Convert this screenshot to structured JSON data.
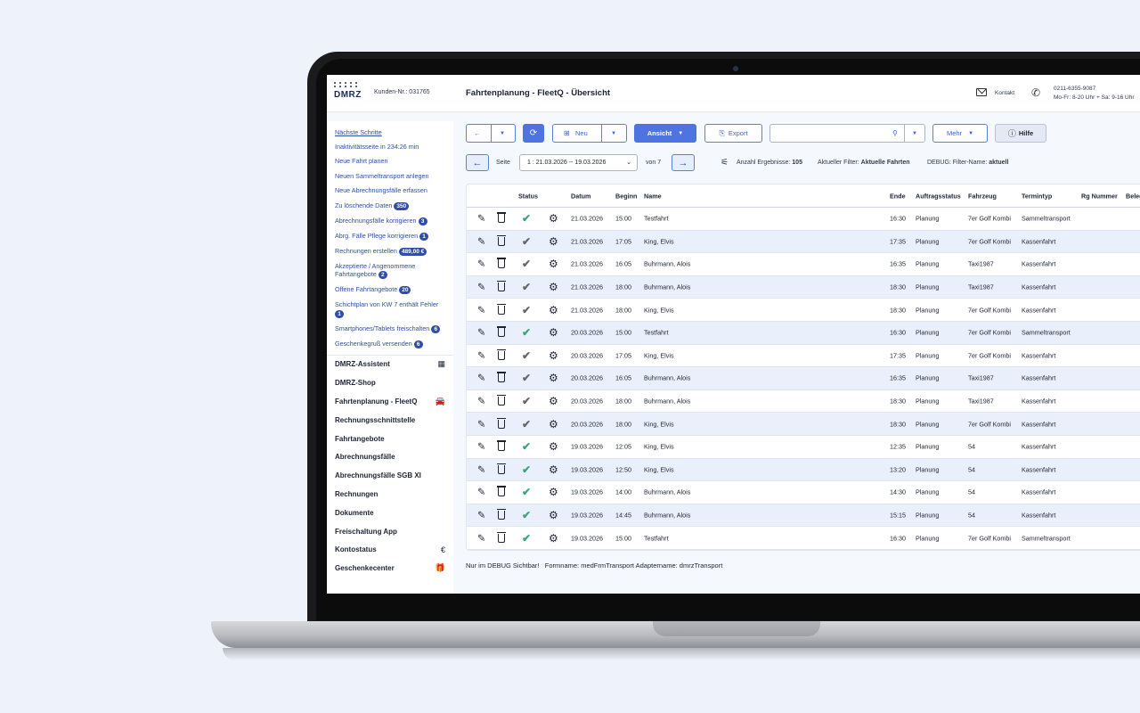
{
  "header": {
    "logo_text": "DMRZ",
    "customer_no": "Kunden-Nr.: 031765",
    "title": "Fahrtenplanung - FleetQ - Übersicht",
    "contact_label": "Kontakt",
    "phone": "0211-6355-9087",
    "hours": "Mo-Fr: 8-20 Uhr + Sa: 9-16 Uhr"
  },
  "sidebar": {
    "steps_title": "Nächste Schritte",
    "steps": [
      {
        "label": "Inaktivitätsseite in 234:26 min",
        "badge": ""
      },
      {
        "label": "Neue Fahrt planen",
        "badge": ""
      },
      {
        "label": "Neuen Sammeltransport anlegen",
        "badge": ""
      },
      {
        "label": "Neue Abrechnungsfälle erfassen",
        "badge": ""
      },
      {
        "label": "Zu löschende Daten",
        "badge": "350"
      },
      {
        "label": "Abrechnungsfälle korrigieren",
        "badge": "3"
      },
      {
        "label": "Abrg. Fälle Pflege korrigieren",
        "badge": "1"
      },
      {
        "label": "Rechnungen erstellen",
        "badge": "489,00 €"
      },
      {
        "label": "Akzeptierte / Angenommene Fahrtangebote",
        "badge": "2"
      },
      {
        "label": "Offene Fahrtangebote",
        "badge": "20"
      },
      {
        "label": "Schichtplan von KW 7 enthält Fehler",
        "badge": "1"
      },
      {
        "label": "Smartphones/Tablets freischalten",
        "badge": "6"
      },
      {
        "label": "Geschenkegruß versenden",
        "badge": "6"
      }
    ],
    "nav": [
      {
        "label": "DMRZ-Assistent",
        "icon": "qr-icon",
        "glyph": "▦"
      },
      {
        "label": "DMRZ-Shop",
        "icon": "",
        "glyph": ""
      },
      {
        "label": "Fahrtenplanung - FleetQ",
        "icon": "car-icon",
        "glyph": "🚘"
      },
      {
        "label": "Rechnungsschnittstelle",
        "icon": "",
        "glyph": ""
      },
      {
        "label": "Fahrtangebote",
        "icon": "",
        "glyph": ""
      },
      {
        "label": "Abrechnungsfälle",
        "icon": "",
        "glyph": ""
      },
      {
        "label": "Abrechnungsfälle SGB XI",
        "icon": "",
        "glyph": ""
      },
      {
        "label": "Rechnungen",
        "icon": "",
        "glyph": ""
      },
      {
        "label": "Dokumente",
        "icon": "",
        "glyph": ""
      },
      {
        "label": "Freischaltung App",
        "icon": "",
        "glyph": ""
      },
      {
        "label": "Kontostatus",
        "icon": "euro-icon",
        "glyph": "€"
      },
      {
        "label": "Geschenkecenter",
        "icon": "gift-icon",
        "glyph": "🎁"
      }
    ]
  },
  "toolbar": {
    "new_label": "Neu",
    "view_label": "Ansicht",
    "export_label": "Export",
    "search_placeholder": "",
    "more_label": "Mehr",
    "help_label": "Hilfe"
  },
  "pager": {
    "page_label": "Seite",
    "page_value": "1 : 21.03.2026 -- 19.03.2026",
    "of_label": "von 7",
    "results_label": "Anzahl Ergebnisse:",
    "results_value": "105",
    "filter_label": "Aktueller Filter:",
    "filter_value": "Aktuelle Fahrten",
    "debug_filter_label": "DEBUG: Filter-Name:",
    "debug_filter_value": "aktuell"
  },
  "table": {
    "headers": {
      "status": "Status",
      "datum": "Datum",
      "beginn": "Beginn",
      "name": "Name",
      "ende": "Ende",
      "auftragsstatus": "Auftragsstatus",
      "fahrzeug": "Fahrzeug",
      "termintyp": "Termintyp",
      "rg_nummer": "Rg Nummer",
      "beleg": "Beleg"
    },
    "rows": [
      {
        "status": "green",
        "datum": "21.03.2026",
        "beginn": "15:00",
        "name": "Testfahrt",
        "ende": "16:30",
        "auftragsstatus": "Planung",
        "fahrzeug": "7er Golf Kombi",
        "termintyp": "Sammeltransport"
      },
      {
        "status": "gray",
        "datum": "21.03.2026",
        "beginn": "17:05",
        "name": "King, Elvis",
        "ende": "17:35",
        "auftragsstatus": "Planung",
        "fahrzeug": "7er Golf Kombi",
        "termintyp": "Kassenfahrt"
      },
      {
        "status": "gray",
        "datum": "21.03.2026",
        "beginn": "16:05",
        "name": "Buhrmann, Alois",
        "ende": "16:35",
        "auftragsstatus": "Planung",
        "fahrzeug": "Taxi1987",
        "termintyp": "Kassenfahrt"
      },
      {
        "status": "gray",
        "datum": "21.03.2026",
        "beginn": "18:00",
        "name": "Buhrmann, Alois",
        "ende": "18:30",
        "auftragsstatus": "Planung",
        "fahrzeug": "Taxi1987",
        "termintyp": "Kassenfahrt"
      },
      {
        "status": "gray",
        "datum": "21.03.2026",
        "beginn": "18:00",
        "name": "King, Elvis",
        "ende": "18:30",
        "auftragsstatus": "Planung",
        "fahrzeug": "7er Golf Kombi",
        "termintyp": "Kassenfahrt"
      },
      {
        "status": "green",
        "datum": "20.03.2026",
        "beginn": "15:00",
        "name": "Testfahrt",
        "ende": "16:30",
        "auftragsstatus": "Planung",
        "fahrzeug": "7er Golf Kombi",
        "termintyp": "Sammeltransport"
      },
      {
        "status": "gray",
        "datum": "20.03.2026",
        "beginn": "17:05",
        "name": "King, Elvis",
        "ende": "17:35",
        "auftragsstatus": "Planung",
        "fahrzeug": "7er Golf Kombi",
        "termintyp": "Kassenfahrt"
      },
      {
        "status": "gray",
        "datum": "20.03.2026",
        "beginn": "16:05",
        "name": "Buhrmann, Alois",
        "ende": "16:35",
        "auftragsstatus": "Planung",
        "fahrzeug": "Taxi1987",
        "termintyp": "Kassenfahrt"
      },
      {
        "status": "gray",
        "datum": "20.03.2026",
        "beginn": "18:00",
        "name": "Buhrmann, Alois",
        "ende": "18:30",
        "auftragsstatus": "Planung",
        "fahrzeug": "Taxi1987",
        "termintyp": "Kassenfahrt"
      },
      {
        "status": "gray",
        "datum": "20.03.2026",
        "beginn": "18:00",
        "name": "King, Elvis",
        "ende": "18:30",
        "auftragsstatus": "Planung",
        "fahrzeug": "7er Golf Kombi",
        "termintyp": "Kassenfahrt"
      },
      {
        "status": "green",
        "datum": "19.03.2026",
        "beginn": "12:05",
        "name": "King, Elvis",
        "ende": "12:35",
        "auftragsstatus": "Planung",
        "fahrzeug": "54",
        "termintyp": "Kassenfahrt"
      },
      {
        "status": "green",
        "datum": "19.03.2026",
        "beginn": "12:50",
        "name": "King, Elvis",
        "ende": "13:20",
        "auftragsstatus": "Planung",
        "fahrzeug": "54",
        "termintyp": "Kassenfahrt"
      },
      {
        "status": "green",
        "datum": "19.03.2026",
        "beginn": "14:00",
        "name": "Buhrmann, Alois",
        "ende": "14:30",
        "auftragsstatus": "Planung",
        "fahrzeug": "54",
        "termintyp": "Kassenfahrt"
      },
      {
        "status": "green",
        "datum": "19.03.2026",
        "beginn": "14:45",
        "name": "Buhrmann, Alois",
        "ende": "15:15",
        "auftragsstatus": "Planung",
        "fahrzeug": "54",
        "termintyp": "Kassenfahrt"
      },
      {
        "status": "green",
        "datum": "19.03.2026",
        "beginn": "15:00",
        "name": "Testfahrt",
        "ende": "16:30",
        "auftragsstatus": "Planung",
        "fahrzeug": "7er Golf Kombi",
        "termintyp": "Sammeltransport"
      }
    ]
  },
  "footer": {
    "debug_text": "Nur im DEBUG Sichtbar!   Formname: medFrmTransport Adaptername: dmrzTransport"
  },
  "colors": {
    "accent": "#4d74e0",
    "link": "#2f4ea8",
    "status_green": "#3aa776",
    "status_gray": "#666666"
  }
}
